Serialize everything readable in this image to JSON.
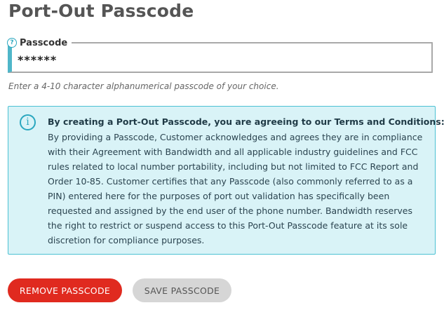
{
  "page": {
    "title": "Port-Out Passcode"
  },
  "passcode_field": {
    "label": "Passcode",
    "help_icon": "question-circle-icon",
    "help_glyph": "?",
    "value": "******",
    "hint": "Enter a 4-10 character alphanumerical passcode of your choice."
  },
  "notice": {
    "icon": "info-icon",
    "icon_glyph": "i",
    "heading": "By creating a Port-Out Passcode, you are agreeing to our Terms and Conditions:",
    "body": "By providing a Passcode, Customer acknowledges and agrees they are in compliance with their Agreement with Bandwidth and all applicable industry guidelines and FCC rules related to local number portability, including but not limited to FCC Report and Order 10-85. Customer certifies that any Passcode (also commonly referred to as a PIN) entered here for the purposes of port out validation has specifically been requested and assigned by the end user of the phone number. Bandwidth reserves the right to restrict or suspend access to this Port-Out Passcode feature at its sole discretion for compliance purposes."
  },
  "actions": {
    "remove_label": "REMOVE PASSCODE",
    "save_label": "SAVE PASSCODE"
  },
  "colors": {
    "accent": "#4fb6c9",
    "notice_bg": "#d9f3f7",
    "danger": "#e02a1f",
    "disabled": "#d6d6d6"
  }
}
